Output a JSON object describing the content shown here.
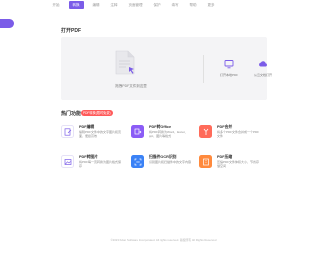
{
  "topnav": {
    "tabs": [
      {
        "label": "开始",
        "active": false
      },
      {
        "label": "转换",
        "active": true
      },
      {
        "label": "编辑",
        "active": false
      },
      {
        "label": "注释",
        "active": false
      },
      {
        "label": "页面管理",
        "active": false
      },
      {
        "label": "保护",
        "active": false
      },
      {
        "label": "填写",
        "active": false
      },
      {
        "label": "帮助",
        "active": false
      },
      {
        "label": "更多",
        "active": false
      }
    ]
  },
  "open_pdf": {
    "title": "打开PDF",
    "drop_text": "拖拽PDF文件到这里",
    "quick_actions": [
      {
        "label": "打开本地PDF",
        "icon": "monitor-icon",
        "color": "#7b5ce8"
      },
      {
        "label": "从云文档打开",
        "icon": "cloud-icon",
        "color": "#7b5ce8"
      }
    ]
  },
  "tools": {
    "title": "热门功能",
    "badge": "PDF转换(限时免费)",
    "items": [
      {
        "title": "PDF编辑",
        "desc": "编辑PDF文件中的文字图片和页面，便捷高效",
        "icon": "pdf-edit-icon",
        "color": "#ffffff",
        "border": "#7b5ce8"
      },
      {
        "title": "PDF转Office",
        "desc": "将PDF转换为Word、Excel、ppt、图片等格式",
        "icon": "convert-icon",
        "color": "#8b5cf6",
        "border": "#8b5cf6"
      },
      {
        "title": "PDF合并",
        "desc": "将多个PDF文件合并成一个PDF文件",
        "icon": "merge-icon",
        "color": "#ff6b5a",
        "border": "#ff6b5a"
      },
      {
        "title": "PDF转图片",
        "desc": "将PDF每一页转换为图片格式保存",
        "icon": "pdf-image-icon",
        "color": "#ffffff",
        "border": "#7b5ce8"
      },
      {
        "title": "扫描件OCR识别",
        "desc": "识别图片和扫描件中的文字内容",
        "icon": "ocr-icon",
        "color": "#3b82f6",
        "border": "#3b82f6"
      },
      {
        "title": "PDF压缩",
        "desc": "压缩PDF文件体积大小，节省存储空间",
        "icon": "compress-icon",
        "color": "#ff8a3d",
        "border": "#ff8a3d"
      }
    ]
  },
  "footer": {
    "text": "©2023 Kdan Software Incorporated. All rights reserved. 版权所有 All Rights Reserved"
  }
}
